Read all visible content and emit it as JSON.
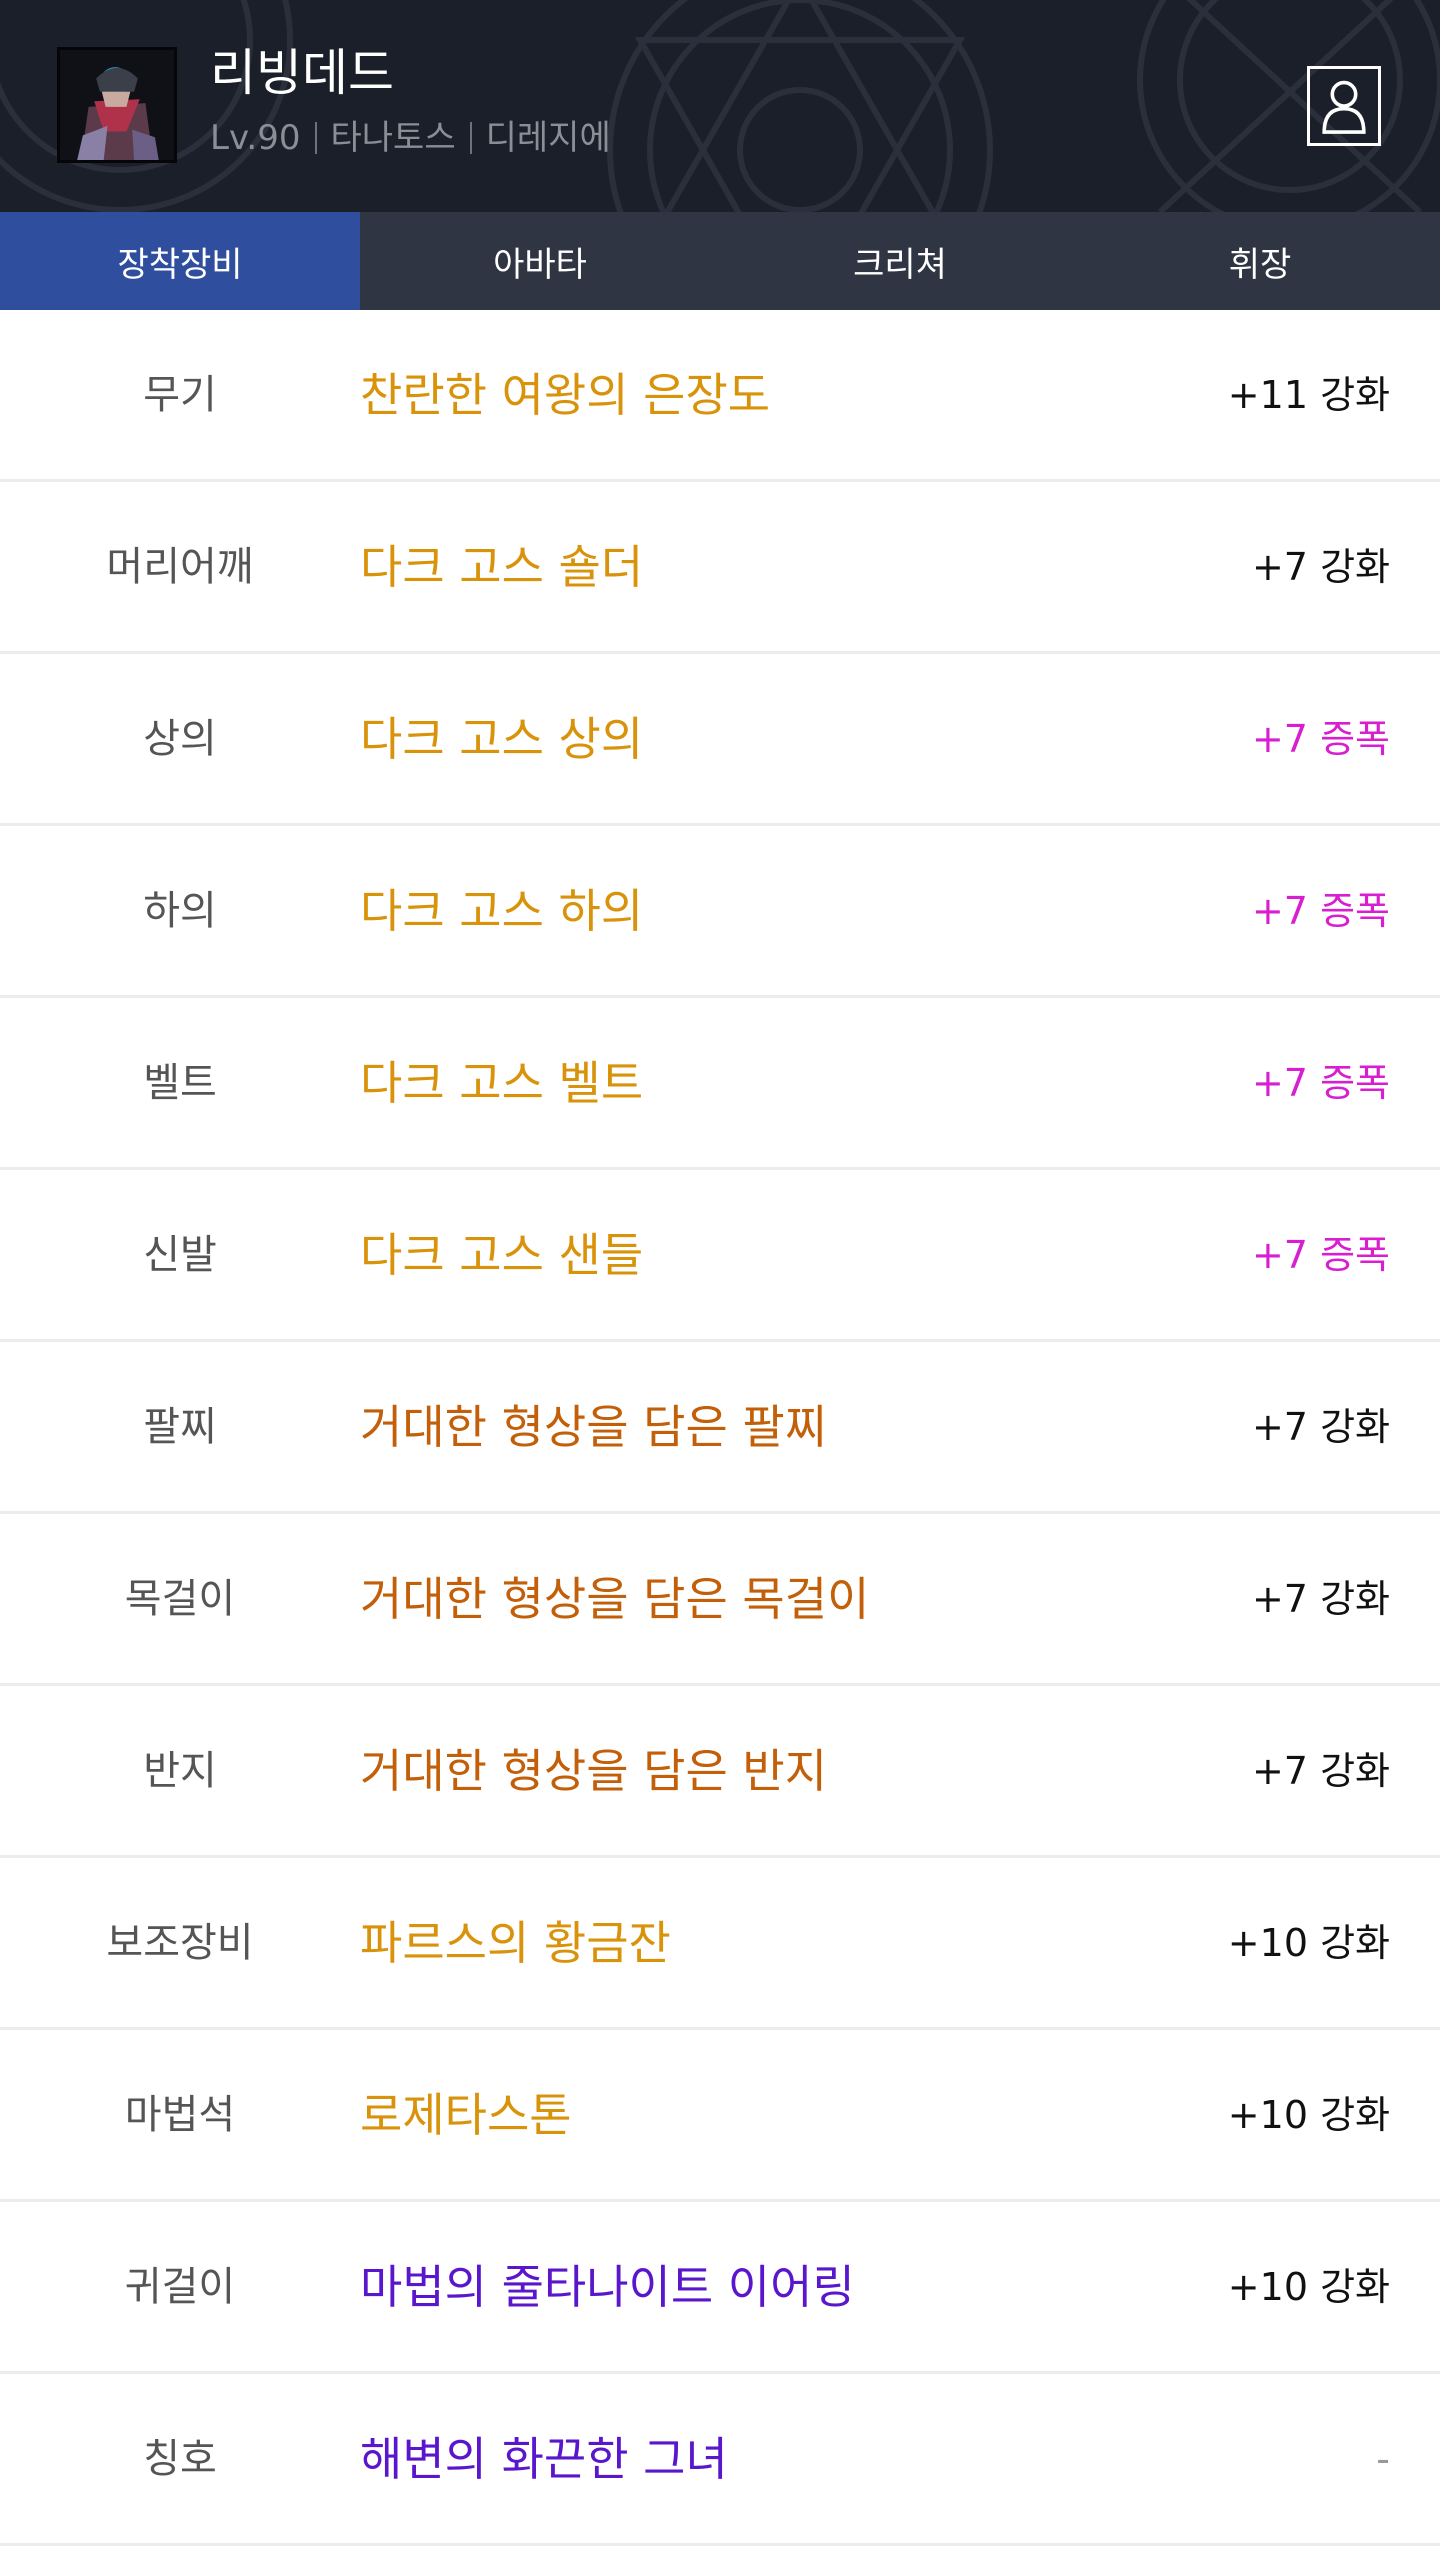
{
  "character": {
    "name": "리빙데드",
    "level": "Lv.90",
    "server": "타나토스",
    "job": "디레지에"
  },
  "tabs": [
    {
      "label": "장착장비",
      "active": true
    },
    {
      "label": "아바타",
      "active": false
    },
    {
      "label": "크리쳐",
      "active": false
    },
    {
      "label": "휘장",
      "active": false
    }
  ],
  "colors": {
    "header_bg": "#1b1f29",
    "tab_bar_bg": "#2f3542",
    "tab_active_bg": "#2f4f9e",
    "epic_gold": "#d9930a",
    "legendary_orange": "#c35f08",
    "unique_purple": "#5a16cc",
    "amplify_magenta": "#d81ed0",
    "reinforce_black": "#111111",
    "slot_gray": "#555555"
  },
  "equipment": [
    {
      "slot": "무기",
      "item": "찬란한 여왕의 은장도",
      "enhance": "+11 강화",
      "item_color": "#d9930a",
      "enhance_color": "#111111"
    },
    {
      "slot": "머리어깨",
      "item": "다크 고스 숄더",
      "enhance": "+7 강화",
      "item_color": "#d9930a",
      "enhance_color": "#111111"
    },
    {
      "slot": "상의",
      "item": "다크 고스 상의",
      "enhance": "+7 증폭",
      "item_color": "#d9930a",
      "enhance_color": "#d81ed0"
    },
    {
      "slot": "하의",
      "item": "다크 고스 하의",
      "enhance": "+7 증폭",
      "item_color": "#d9930a",
      "enhance_color": "#d81ed0"
    },
    {
      "slot": "벨트",
      "item": "다크 고스 벨트",
      "enhance": "+7 증폭",
      "item_color": "#d9930a",
      "enhance_color": "#d81ed0"
    },
    {
      "slot": "신발",
      "item": "다크 고스 샌들",
      "enhance": "+7 증폭",
      "item_color": "#d9930a",
      "enhance_color": "#d81ed0"
    },
    {
      "slot": "팔찌",
      "item": "거대한 형상을 담은 팔찌",
      "enhance": "+7 강화",
      "item_color": "#c35f08",
      "enhance_color": "#111111"
    },
    {
      "slot": "목걸이",
      "item": "거대한 형상을 담은 목걸이",
      "enhance": "+7 강화",
      "item_color": "#c35f08",
      "enhance_color": "#111111"
    },
    {
      "slot": "반지",
      "item": "거대한 형상을 담은 반지",
      "enhance": "+7 강화",
      "item_color": "#c35f08",
      "enhance_color": "#111111"
    },
    {
      "slot": "보조장비",
      "item": "파르스의 황금잔",
      "enhance": "+10 강화",
      "item_color": "#d9930a",
      "enhance_color": "#111111"
    },
    {
      "slot": "마법석",
      "item": "로제타스톤",
      "enhance": "+10 강화",
      "item_color": "#d9930a",
      "enhance_color": "#111111"
    },
    {
      "slot": "귀걸이",
      "item": "마법의 줄타나이트 이어링",
      "enhance": "+10 강화",
      "item_color": "#5a16cc",
      "enhance_color": "#111111"
    },
    {
      "slot": "칭호",
      "item": "해변의 화끈한 그녀",
      "enhance": "-",
      "item_color": "#5a16cc",
      "enhance_color": "#999999"
    }
  ]
}
